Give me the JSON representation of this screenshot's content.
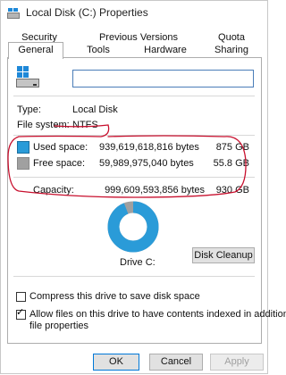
{
  "window": {
    "title": "Local Disk (C:) Properties"
  },
  "tabs": {
    "row1": [
      "Security",
      "Previous Versions",
      "Quota"
    ],
    "row2": [
      "General",
      "Tools",
      "Hardware",
      "Sharing"
    ],
    "active": "General"
  },
  "general": {
    "name_value": "",
    "type_label": "Type:",
    "type_value": "Local Disk",
    "filesystem_label": "File system:",
    "filesystem_value": "NTFS",
    "used_label": "Used space:",
    "used_bytes": "939,619,618,816 bytes",
    "used_size": "875 GB",
    "free_label": "Free space:",
    "free_bytes": "59,989,975,040 bytes",
    "free_size": "55.8 GB",
    "capacity_label": "Capacity:",
    "capacity_bytes": "999,609,593,856 bytes",
    "capacity_size": "930 GB",
    "drive_label": "Drive C:",
    "cleanup_label": "Disk Cleanup",
    "compress_label": "Compress this drive to save disk space",
    "compress_checked": false,
    "index_label_line1": "Allow files on this drive to have contents indexed in addition to",
    "index_label_line2": "file properties",
    "index_checked": true,
    "used_fraction": 0.94
  },
  "colors": {
    "used": "#2a9bd8",
    "free": "#a0a0a0",
    "annotation": "#c8102e",
    "accent": "#0078d7"
  },
  "footer": {
    "ok_label": "OK",
    "cancel_label": "Cancel",
    "apply_label": "Apply"
  }
}
